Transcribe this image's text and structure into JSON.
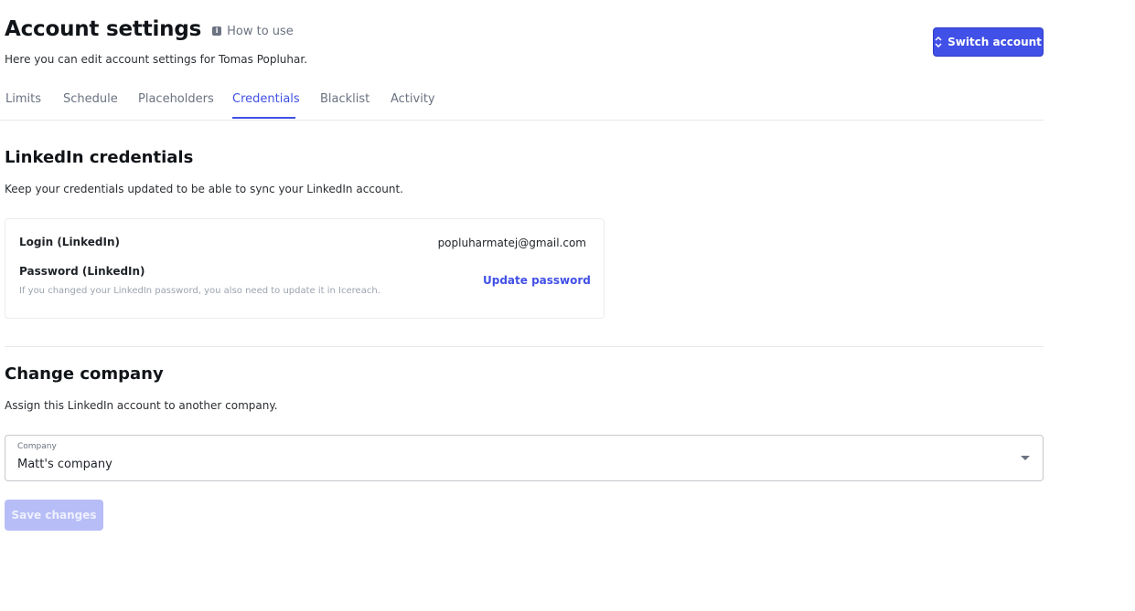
{
  "header": {
    "title": "Account settings",
    "how_to_use": "How to use",
    "subtitle": "Here you can edit account settings for Tomas Popluhar.",
    "switch_account": "Switch account"
  },
  "tabs": [
    {
      "label": "Limits",
      "active": false
    },
    {
      "label": "Schedule",
      "active": false
    },
    {
      "label": "Placeholders",
      "active": false
    },
    {
      "label": "Credentials",
      "active": true
    },
    {
      "label": "Blacklist",
      "active": false
    },
    {
      "label": "Activity",
      "active": false
    }
  ],
  "credentials": {
    "title": "LinkedIn credentials",
    "description": "Keep your credentials updated to be able to sync your LinkedIn account.",
    "login_label": "Login (LinkedIn)",
    "login_value": "popluharmatej@gmail.com",
    "password_label": "Password (LinkedIn)",
    "password_hint": "If you changed your LinkedIn password, you also need to update it in Icereach.",
    "update_password": "Update password"
  },
  "company": {
    "title": "Change company",
    "description": "Assign this LinkedIn account to another company.",
    "field_label": "Company",
    "selected": "Matt's company"
  },
  "save_button": "Save changes",
  "colors": {
    "accent": "#4150e6",
    "disabled_button": "#b7bdf6"
  }
}
